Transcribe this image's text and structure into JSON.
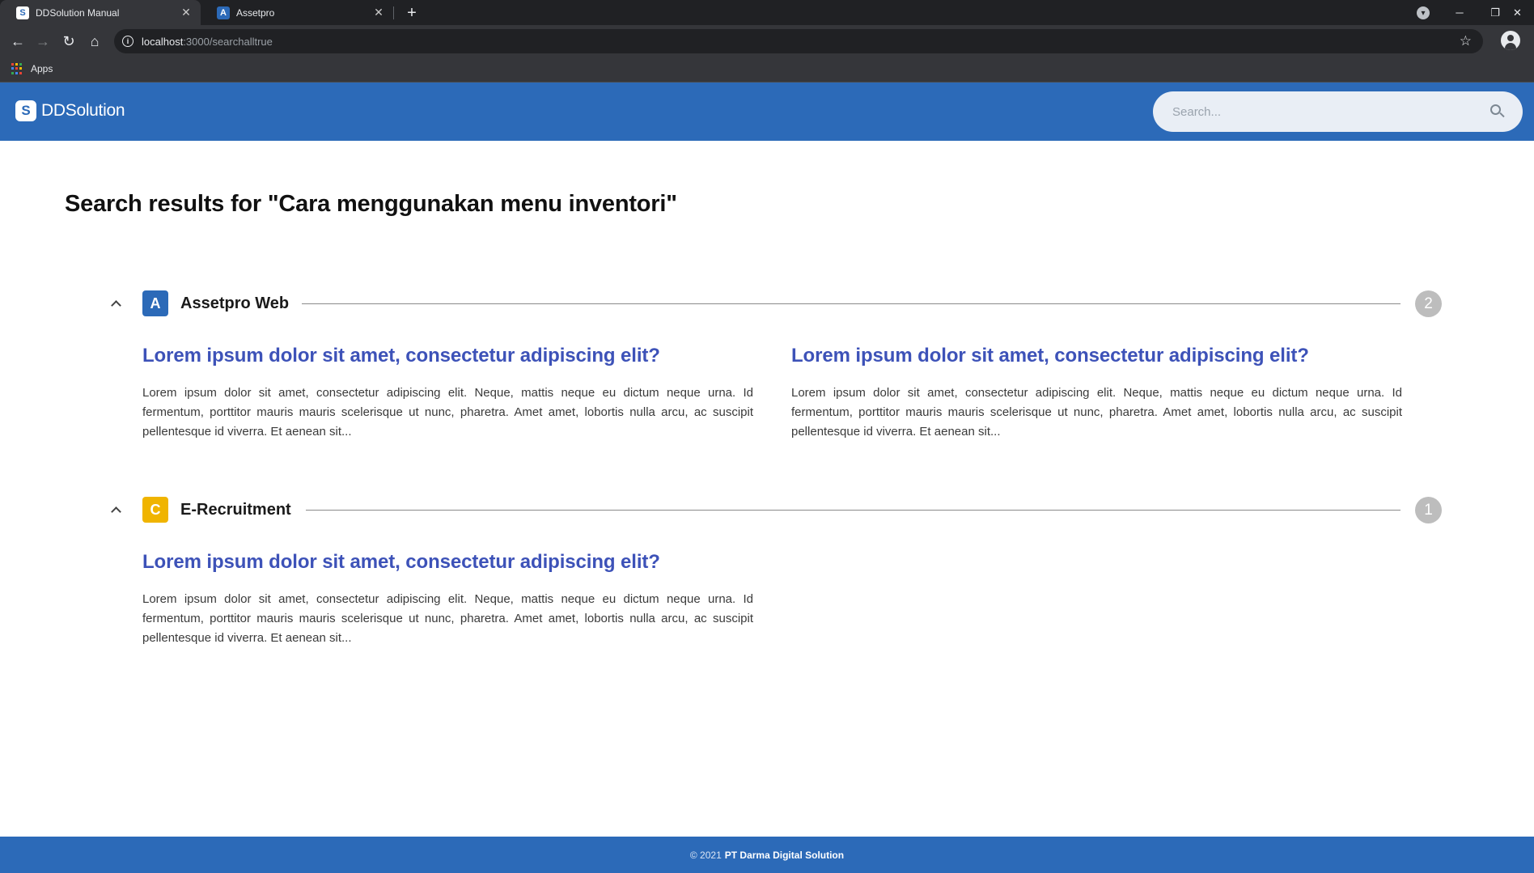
{
  "browser": {
    "tabs": [
      {
        "title": "DDSolution Manual",
        "favicon": "S",
        "active": true
      },
      {
        "title": "Assetpro",
        "favicon": "A",
        "active": false
      }
    ],
    "new_tab_label": "+",
    "url_host": "localhost",
    "url_path": ":3000/searchalltrue",
    "bookmarks": {
      "apps_label": "Apps"
    }
  },
  "header": {
    "logo_mark": "S",
    "logo_text": "DDSolution",
    "search_placeholder": "Search..."
  },
  "main": {
    "title": "Search results for \"Cara menggunakan menu inventori\"",
    "groups": [
      {
        "name": "Assetpro Web",
        "icon": "A",
        "icon_color": "#2c6ab8",
        "count": "2",
        "results": [
          {
            "title": "Lorem ipsum dolor sit amet, consectetur adipiscing elit?",
            "snippet": "Lorem ipsum dolor sit amet, consectetur adipiscing elit. Neque, mattis neque eu dictum neque urna. Id fermentum, porttitor mauris mauris scelerisque ut nunc, pharetra. Amet amet, lobortis nulla arcu, ac suscipit pellentesque id viverra. Et aenean sit..."
          },
          {
            "title": "Lorem ipsum dolor sit amet, consectetur adipiscing elit?",
            "snippet": "Lorem ipsum dolor sit amet, consectetur adipiscing elit. Neque, mattis neque eu dictum neque urna. Id fermentum, porttitor mauris mauris scelerisque ut nunc, pharetra. Amet amet, lobortis nulla arcu, ac suscipit pellentesque id viverra. Et aenean sit..."
          }
        ]
      },
      {
        "name": "E-Recruitment",
        "icon": "C",
        "icon_color": "#f0b400",
        "count": "1",
        "results": [
          {
            "title": "Lorem ipsum dolor sit amet, consectetur adipiscing elit?",
            "snippet": "Lorem ipsum dolor sit amet, consectetur adipiscing elit. Neque, mattis neque eu dictum neque urna. Id fermentum, porttitor mauris mauris scelerisque ut nunc, pharetra. Amet amet, lobortis nulla arcu, ac suscipit pellentesque id viverra. Et aenean sit..."
          }
        ]
      }
    ]
  },
  "footer": {
    "copyright": "© 2021",
    "company": "PT Darma Digital Solution"
  },
  "colors": {
    "brand_blue": "#2c6ab8",
    "link_blue": "#3d52b8",
    "badge_gray": "#bdbdbd"
  }
}
